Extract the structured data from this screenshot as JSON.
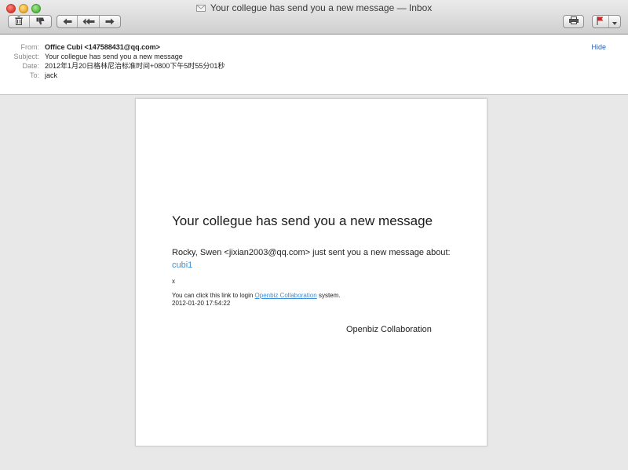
{
  "window": {
    "title": "Your collegue has send you a new message — Inbox"
  },
  "toolbar": {
    "delete_icon": "trash-icon",
    "junk_icon": "thumbs-down-icon",
    "reply_icon": "reply-arrow-icon",
    "reply_all_icon": "reply-all-arrow-icon",
    "forward_icon": "forward-arrow-icon",
    "print_icon": "printer-icon",
    "flag_icon": "flag-icon"
  },
  "header": {
    "from_label": "From:",
    "from_value": "Office Cubi <147588431@qq.com>",
    "subject_label": "Subject:",
    "subject_value": "Your collegue has send you a new message",
    "date_label": "Date:",
    "date_value": "2012年1月20日格林尼治标准时间+0800下午5时55分01秒",
    "to_label": "To:",
    "to_value": "jack",
    "hide_label": "Hide"
  },
  "message": {
    "title": "Your collegue has send you a new message",
    "intro": "Rocky, Swen <jixian2003@qq.com> just sent you a new message about:",
    "topic_link": "cubi1",
    "body": "x",
    "login_prefix": "You can click this link to login ",
    "login_link": "Openbiz Collaboration",
    "login_suffix": " system.",
    "timestamp": "2012-01-20 17:54:22",
    "signature": "Openbiz Collaboration"
  },
  "colors": {
    "link": "#3a8fd6",
    "hide_link": "#2a5db0",
    "flag": "#d0282a"
  }
}
